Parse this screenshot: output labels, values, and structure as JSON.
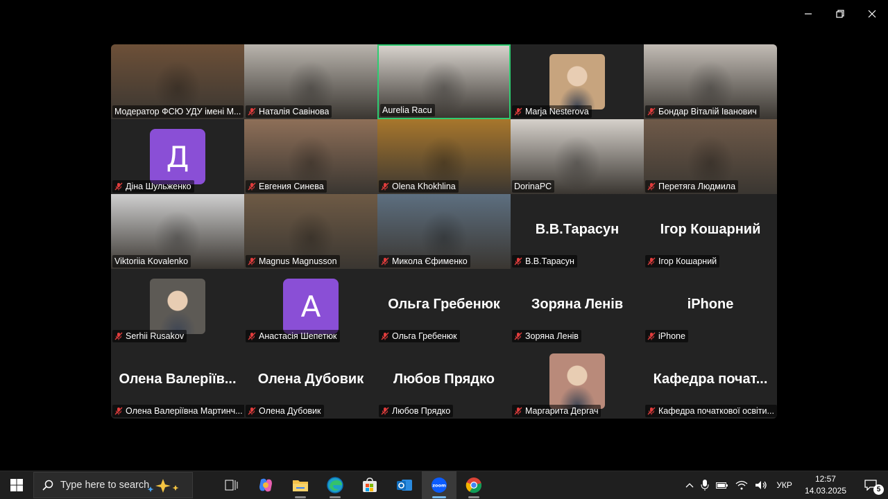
{
  "window_controls": [
    "minimize",
    "restore",
    "close"
  ],
  "gallery": {
    "active_speaker_color": "#2ecc71",
    "avatar_color": "#8a4fd6",
    "tiles": [
      {
        "name": "Модератор ФСЮ УДУ імені М...",
        "muted": false,
        "kind": "video",
        "bg": "#6d5038"
      },
      {
        "name": "Наталія Савінова",
        "muted": true,
        "kind": "video",
        "bg": "#b9b4ad"
      },
      {
        "name": "Aurelia Racu",
        "muted": false,
        "kind": "video",
        "bg": "#d7d2cc",
        "active": true
      },
      {
        "name": "Marja Nesterova",
        "muted": true,
        "kind": "photo",
        "bg": "#c7a47e"
      },
      {
        "name": "Бондар Віталій Іванович",
        "muted": true,
        "kind": "video",
        "bg": "#c2bcb5"
      },
      {
        "name": "Діна Шульженко",
        "muted": true,
        "kind": "avatar",
        "initial": "Д"
      },
      {
        "name": "Евгения Синева",
        "muted": true,
        "kind": "video",
        "bg": "#8e6f58"
      },
      {
        "name": "Olena Khokhlina",
        "muted": true,
        "kind": "video",
        "bg": "#a8772c"
      },
      {
        "name": "DorinaPC",
        "muted": false,
        "kind": "video",
        "bg": "#d6d1cb"
      },
      {
        "name": "Перетяга Людмила",
        "muted": true,
        "kind": "video",
        "bg": "#6f5a49"
      },
      {
        "name": "Viktoriia Kovalenko",
        "muted": false,
        "kind": "video",
        "bg": "#cfcfcf"
      },
      {
        "name": "Magnus Magnusson",
        "muted": true,
        "kind": "video",
        "bg": "#6e5a45"
      },
      {
        "name": "Микола Єфименко",
        "muted": true,
        "kind": "video",
        "bg": "#5d6f80"
      },
      {
        "name": "В.В.Тарасун",
        "muted": true,
        "kind": "name",
        "display": "В.В.Тарасун"
      },
      {
        "name": "Ігор Кошарний",
        "muted": true,
        "kind": "name",
        "display": "Ігор Кошарний"
      },
      {
        "name": "Serhii Rusakov",
        "muted": true,
        "kind": "photo",
        "bg": "#5d5a55"
      },
      {
        "name": "Анастасія Шепетюк",
        "muted": true,
        "kind": "avatar",
        "initial": "А"
      },
      {
        "name": "Ольга Гребенюк",
        "muted": true,
        "kind": "name",
        "display": "Ольга Гребенюк"
      },
      {
        "name": "Зоряна Ленів",
        "muted": true,
        "kind": "name",
        "display": "Зоряна Ленів"
      },
      {
        "name": "iPhone",
        "muted": true,
        "kind": "name",
        "display": "iPhone"
      },
      {
        "name": "Олена Валеріївна Мартинч...",
        "muted": true,
        "kind": "name",
        "display": "Олена Валеріїв..."
      },
      {
        "name": "Олена Дубовик",
        "muted": true,
        "kind": "name",
        "display": "Олена Дубовик"
      },
      {
        "name": "Любов Прядко",
        "muted": true,
        "kind": "name",
        "display": "Любов Прядко"
      },
      {
        "name": "Маргарита Дергач",
        "muted": true,
        "kind": "photo",
        "bg": "#b98a7a"
      },
      {
        "name": "Кафедра початкової освіти...",
        "muted": true,
        "kind": "name",
        "display": "Кафедра почат..."
      }
    ]
  },
  "taskbar": {
    "search_placeholder": "Type here to search",
    "apps": [
      {
        "icon": "task-view-icon",
        "running": false
      },
      {
        "icon": "copilot-icon",
        "running": false
      },
      {
        "icon": "file-explorer-icon",
        "running": true
      },
      {
        "icon": "edge-icon",
        "running": true
      },
      {
        "icon": "microsoft-store-icon",
        "running": false
      },
      {
        "icon": "outlook-icon",
        "running": false
      },
      {
        "icon": "zoom-icon",
        "running": true,
        "active": true
      },
      {
        "icon": "chrome-icon",
        "running": true
      }
    ],
    "tray": {
      "language": "УКР",
      "time": "12:57",
      "date": "14.03.2025",
      "notifications": "5"
    }
  }
}
